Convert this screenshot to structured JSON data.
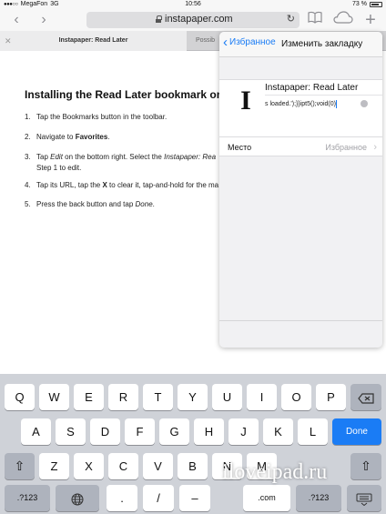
{
  "status_bar": {
    "carrier": "MegaFon",
    "network": "3G",
    "time": "10:56",
    "battery": "73 %"
  },
  "toolbar": {
    "url": "instapaper.com",
    "icons": {
      "back": "chevron-left-icon",
      "forward": "chevron-right-icon",
      "reload": "reload-icon",
      "bookmarks": "book-icon",
      "icloud": "cloud-icon",
      "add": "plus-icon"
    }
  },
  "tabs": {
    "active_label": "Instapaper: Read Later",
    "second_label": "Possib"
  },
  "article": {
    "title": "Installing the Read Later bookmark on iPad",
    "steps": [
      {
        "num": "1.",
        "text": "Tap the Bookmarks button in the toolbar."
      },
      {
        "num": "2.",
        "text_pre": "Navigate to ",
        "text_bold": "Favorites",
        "text_post": "."
      },
      {
        "num": "3.",
        "text_a": "Tap ",
        "text_em": "Edit",
        "text_b": " on the bottom right. Select the ",
        "text_em2": "Instapaper: Rea",
        "text_line2": "Step 1 to edit."
      },
      {
        "num": "4.",
        "text_a": "Tap its URL, tap the ",
        "text_bold": "X",
        "text_b": " to clear it, tap-and-hold for the ma"
      },
      {
        "num": "5.",
        "text_a": "Press the back button and tap ",
        "text_em": "Done",
        "text_b": "."
      }
    ]
  },
  "popover": {
    "back_label": "Избранное",
    "title": "Изменить закладку",
    "bookmark_icon_text": "I",
    "bookmark_name": "Instapaper: Read Later",
    "bookmark_url": "s loaded.');}}ipt5();void(0)",
    "location_label": "Место",
    "location_value": "Избранное"
  },
  "keyboard": {
    "row1": [
      "Q",
      "W",
      "E",
      "R",
      "T",
      "Y",
      "U",
      "I",
      "O",
      "P"
    ],
    "row2": [
      "A",
      "S",
      "D",
      "F",
      "G",
      "H",
      "J",
      "K",
      "L"
    ],
    "done_label": "Done",
    "row3": [
      "Z",
      "X",
      "C",
      "V",
      "B",
      "N",
      "M"
    ],
    "row4_chars": [
      ".",
      "/",
      "–",
      ".com"
    ],
    "numbers_label": ".?123",
    "icons": {
      "backspace": "backspace-icon",
      "shift": "shift-icon",
      "globe": "globe-icon",
      "dismiss": "keyboard-dismiss-icon"
    },
    "colors": {
      "done": "#1a7cf5"
    }
  },
  "watermark": "iloveipad.ru"
}
